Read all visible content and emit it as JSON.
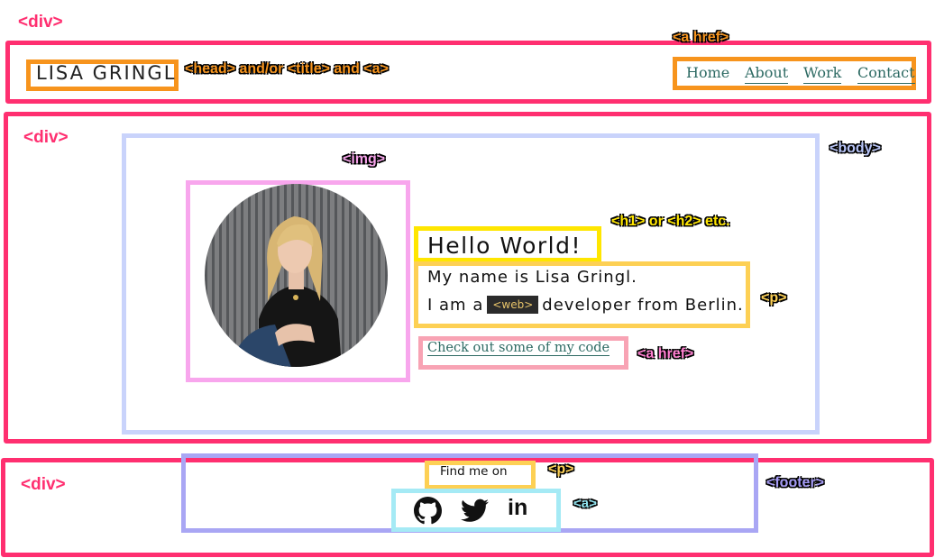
{
  "labels": {
    "div_top": "<div>",
    "div_middle": "<div>",
    "div_bottom": "<div>",
    "a_href_nav": "<a href>",
    "head_title": "<head> and/or <title> and <a>",
    "img": "<img>",
    "body": "<body>",
    "heading": "<h1> or <h2> etc.",
    "p_intro": "<p>",
    "a_href_code": "<a href>",
    "footer": "<footer>",
    "p_footer": "<p>",
    "a_social": "<a>"
  },
  "header": {
    "logo": "LISA GRINGL",
    "nav": [
      "Home",
      "About",
      "Work",
      "Contact"
    ]
  },
  "hero": {
    "heading": "Hello World!",
    "line1": "My name is Lisa Gringl.",
    "line2_before": "I am a",
    "line2_code": "<web>",
    "line2_after": "developer from Berlin.",
    "code_link": "Check out some of my code"
  },
  "footer": {
    "find_me": "Find me on",
    "social_icons": [
      "github-icon",
      "twitter-icon",
      "linkedin-icon"
    ],
    "linkedin_text": "in"
  },
  "colors": {
    "div": "#ff2f70",
    "head": "#f7941d",
    "heading": "#ffe600",
    "paragraph": "#fdd054",
    "body": "#c9d3fb",
    "footer": "#a9a6f4",
    "social_link": "#a5eaf5",
    "code_link": "#f8a3b4",
    "img": "#f8a6ed"
  }
}
